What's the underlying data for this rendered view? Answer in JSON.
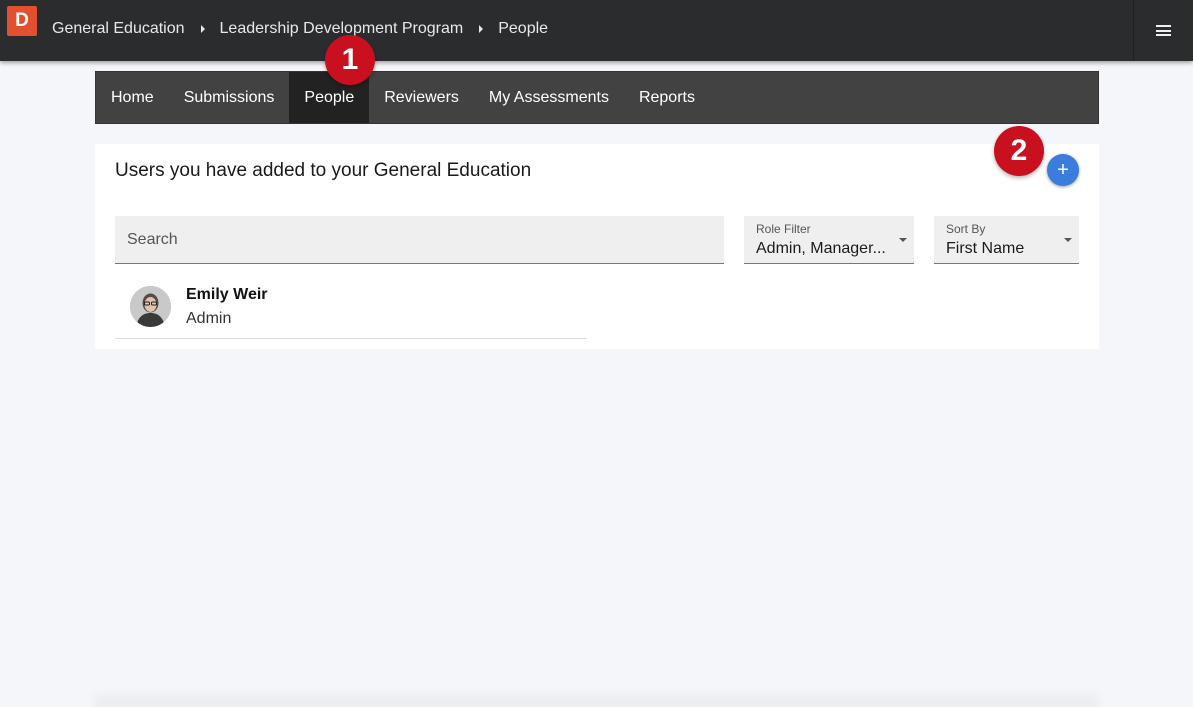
{
  "topbar": {
    "logo_letter": "D",
    "breadcrumbs": [
      "General Education",
      "Leadership Development Program",
      "People"
    ],
    "menu_icon": "hamburger-menu-icon"
  },
  "nav": {
    "items": [
      {
        "label": "Home",
        "active": false
      },
      {
        "label": "Submissions",
        "active": false
      },
      {
        "label": "People",
        "active": true
      },
      {
        "label": "Reviewers",
        "active": false
      },
      {
        "label": "My Assessments",
        "active": false
      },
      {
        "label": "Reports",
        "active": false
      }
    ]
  },
  "callouts": [
    "1",
    "2"
  ],
  "main": {
    "title": "Users you have added to your General Education",
    "add_button_icon": "+",
    "search": {
      "placeholder": "Search",
      "value": ""
    },
    "role_filter": {
      "label": "Role Filter",
      "value": "Admin, Manager..."
    },
    "sort_by": {
      "label": "Sort By",
      "value": "First Name"
    },
    "users": [
      {
        "name": "Emily Weir",
        "role": "Admin"
      }
    ]
  },
  "colors": {
    "topbar": "#2b2c2e",
    "logo": "#e2502e",
    "nav": "#424242",
    "nav_active": "#222222",
    "callout": "#c8101e",
    "add_button": "#3b7ddd",
    "background": "#f5f6fa"
  }
}
